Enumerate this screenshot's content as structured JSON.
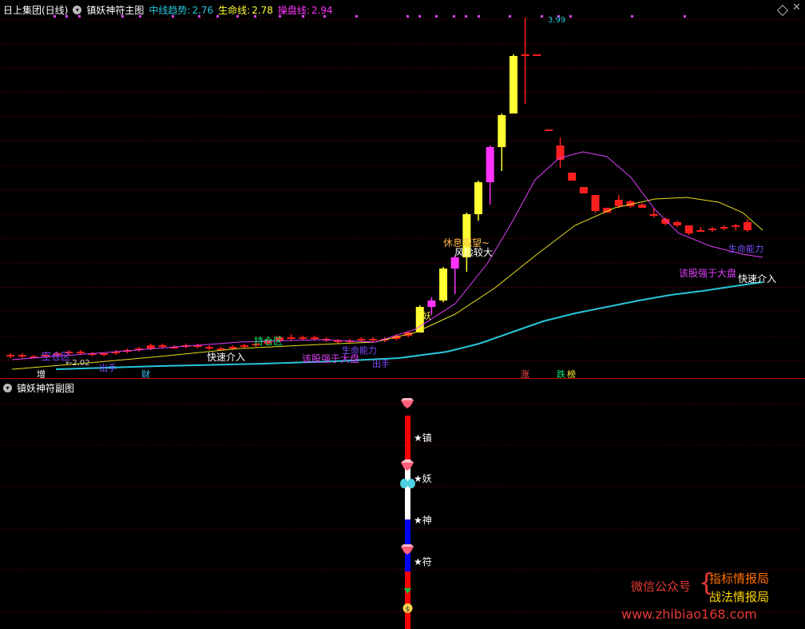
{
  "header": {
    "stock_name": "日上集团(日线)",
    "indicator_title": "镇妖神符主图",
    "mid_label": "中线趋势:",
    "mid_value": "2.76",
    "life_label": "生命线:",
    "life_value": "2.78",
    "op_label": "操盘线:",
    "op_value": "2.94"
  },
  "sub_header": {
    "indicator_title": "镇妖神符副图"
  },
  "chart_data": {
    "type": "candlestick",
    "candles": [
      [
        2.1,
        2.12,
        2.09,
        2.11
      ],
      [
        2.11,
        2.12,
        2.09,
        2.1
      ],
      [
        2.1,
        2.11,
        2.09,
        2.1
      ],
      [
        2.1,
        2.12,
        2.1,
        2.11
      ],
      [
        2.11,
        2.13,
        2.1,
        2.12
      ],
      [
        2.12,
        2.14,
        2.11,
        2.13
      ],
      [
        2.13,
        2.14,
        2.11,
        2.12
      ],
      [
        2.12,
        2.13,
        2.1,
        2.11
      ],
      [
        2.11,
        2.12,
        2.1,
        2.12
      ],
      [
        2.12,
        2.14,
        2.11,
        2.13
      ],
      [
        2.13,
        2.15,
        2.12,
        2.14
      ],
      [
        2.14,
        2.16,
        2.13,
        2.15
      ],
      [
        2.15,
        2.18,
        2.14,
        2.17
      ],
      [
        2.17,
        2.18,
        2.15,
        2.16
      ],
      [
        2.16,
        2.17,
        2.15,
        2.16
      ],
      [
        2.16,
        2.18,
        2.15,
        2.17
      ],
      [
        2.17,
        2.18,
        2.15,
        2.16
      ],
      [
        2.16,
        2.17,
        2.14,
        2.15
      ],
      [
        2.15,
        2.16,
        2.14,
        2.15
      ],
      [
        2.15,
        2.17,
        2.14,
        2.16
      ],
      [
        2.16,
        2.18,
        2.15,
        2.17
      ],
      [
        2.17,
        2.19,
        2.16,
        2.18
      ],
      [
        2.18,
        2.21,
        2.17,
        2.2
      ],
      [
        2.2,
        2.23,
        2.19,
        2.22
      ],
      [
        2.22,
        2.24,
        2.2,
        2.21
      ],
      [
        2.21,
        2.23,
        2.2,
        2.22
      ],
      [
        2.22,
        2.23,
        2.2,
        2.21
      ],
      [
        2.21,
        2.22,
        2.19,
        2.2
      ],
      [
        2.2,
        2.21,
        2.18,
        2.19
      ],
      [
        2.19,
        2.21,
        2.18,
        2.2
      ],
      [
        2.2,
        2.22,
        2.19,
        2.21
      ],
      [
        2.21,
        2.22,
        2.19,
        2.2
      ],
      [
        2.2,
        2.22,
        2.19,
        2.21
      ],
      [
        2.21,
        2.24,
        2.2,
        2.23
      ],
      [
        2.23,
        2.26,
        2.22,
        2.25
      ],
      [
        2.25,
        2.42,
        2.25,
        2.41
      ],
      [
        2.41,
        2.47,
        2.36,
        2.45
      ],
      [
        2.45,
        2.66,
        2.44,
        2.65
      ],
      [
        2.65,
        2.73,
        2.49,
        2.72
      ],
      [
        2.72,
        3.0,
        2.63,
        2.99
      ],
      [
        2.99,
        3.2,
        2.95,
        3.19
      ],
      [
        3.19,
        3.42,
        3.05,
        3.41
      ],
      [
        3.41,
        3.62,
        3.26,
        3.61
      ],
      [
        3.62,
        3.99,
        3.62,
        3.98
      ],
      [
        3.98,
        4.22,
        3.68,
        3.99
      ],
      [
        3.99,
        3.99,
        3.99,
        3.99
      ],
      [
        3.52,
        3.52,
        3.52,
        3.52
      ],
      [
        3.42,
        3.47,
        3.28,
        3.33
      ],
      [
        3.25,
        3.25,
        3.2,
        3.2
      ],
      [
        3.16,
        3.16,
        3.12,
        3.12
      ],
      [
        3.11,
        3.11,
        3.0,
        3.01
      ],
      [
        3.03,
        3.03,
        3.0,
        3.0
      ],
      [
        3.08,
        3.11,
        3.03,
        3.04
      ],
      [
        3.07,
        3.08,
        3.03,
        3.04
      ],
      [
        3.03,
        3.06,
        3.03,
        3.05
      ],
      [
        2.99,
        3.03,
        2.97,
        2.98
      ],
      [
        2.96,
        2.97,
        2.92,
        2.93
      ],
      [
        2.94,
        2.95,
        2.91,
        2.92
      ],
      [
        2.92,
        2.92,
        2.86,
        2.87
      ],
      [
        2.88,
        2.91,
        2.88,
        2.89
      ],
      [
        2.89,
        2.91,
        2.88,
        2.9
      ],
      [
        2.9,
        2.92,
        2.89,
        2.91
      ],
      [
        2.91,
        2.93,
        2.89,
        2.92
      ],
      [
        2.94,
        2.96,
        2.88,
        2.89
      ]
    ],
    "labels": {
      "low_value": "2.02",
      "high_value": "3.99",
      "annotations": [
        "空仓区",
        "增",
        "财",
        "快速介入",
        "持仓区",
        "该股强于大盘",
        "出手",
        "生命能力",
        "妖",
        "风险较大",
        "休息观望~",
        "涨",
        "跌",
        "榜",
        "该股强于大盘",
        "生命能力",
        "快速介入",
        "出手"
      ]
    }
  },
  "sub_chart": {
    "labels": [
      "★镇",
      "★妖",
      "★神",
      "★符"
    ],
    "colors": {
      "red": "#ff0000",
      "white": "#ffffff",
      "blue": "#0000ff"
    }
  },
  "watermark": {
    "left": "微信公众号",
    "right1": "指标情报局",
    "right2": "战法情报局",
    "url": "www.zhibiao168.com"
  }
}
